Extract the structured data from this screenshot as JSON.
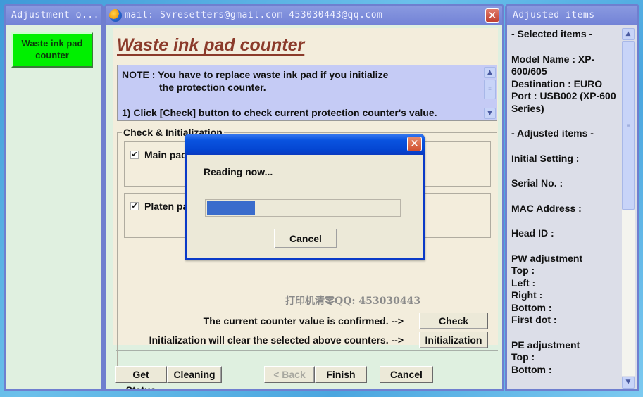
{
  "left_panel": {
    "title": "Adjustment o...",
    "selected_button": "Waste ink pad counter",
    "selected_button_color": "#00f000"
  },
  "main_window": {
    "title": "mail: Svresetters@gmail.com  453030443@qq.com",
    "logo_icon": "app-logo-icon",
    "close_icon": "close-icon",
    "page_title": "Waste ink pad counter",
    "note": {
      "line1": "NOTE : You have to replace waste ink pad if you initialize",
      "line2": "the protection counter.",
      "line3": "1) Click [Check] button to check current protection counter's value."
    },
    "group_label": "Check & Initialization",
    "checkboxes": [
      {
        "label": "Main pad",
        "checked": true
      },
      {
        "label": "Platen pa",
        "checked": true
      }
    ],
    "watermark": "打印机清零QQ: 453030443",
    "check_row": {
      "label": "The current counter value is confirmed. -->",
      "button": "Check"
    },
    "init_row": {
      "label": "Initialization will clear the selected above counters. -->",
      "button": "Initialization"
    },
    "bottom_buttons": {
      "get_status": "Get Status",
      "cleaning": "Cleaning",
      "back": "< Back",
      "finish": "Finish",
      "cancel": "Cancel"
    }
  },
  "right_panel": {
    "title": "Adjusted items",
    "selected_header": "- Selected items -",
    "model_name": "Model Name : XP-600/605",
    "destination": "Destination : EURO",
    "port": "Port : USB002 (XP-600 Series)",
    "adjusted_header": "- Adjusted items -",
    "initial_setting": "Initial Setting :",
    "serial_no": "Serial No. :",
    "mac_address": "MAC Address :",
    "head_id": "Head ID :",
    "pw_adjustment": "PW adjustment",
    "pw_top": "Top :",
    "pw_left": "Left :",
    "pw_right": "Right :",
    "pw_bottom": "Bottom :",
    "first_dot": "First dot :",
    "pe_adjustment": "PE adjustment",
    "pe_top": "Top :",
    "pe_bottom": "Bottom :"
  },
  "dialog": {
    "message": "Reading now...",
    "progress_percent": 25,
    "progress_color": "#3a6ccc",
    "cancel": "Cancel",
    "close_symbol": "✕"
  },
  "icons": {
    "close_symbol": "✕",
    "check_symbol": "✔",
    "scroll_up": "▲",
    "scroll_down": "▼",
    "grip": "≡"
  }
}
